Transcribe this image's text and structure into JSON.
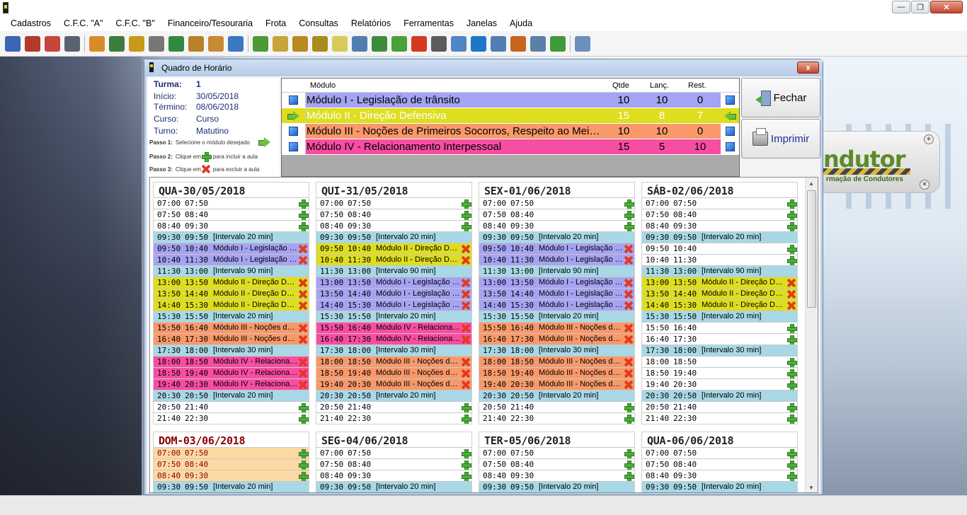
{
  "menu": [
    "Cadastros",
    "C.F.C. \"A\"",
    "C.F.C. \"B\"",
    "Financeiro/Tesouraria",
    "Frota",
    "Consultas",
    "Relatórios",
    "Ferramentas",
    "Janelas",
    "Ajuda"
  ],
  "toolbar_icons": [
    "users-icon",
    "truck-icon",
    "shop-icon",
    "car-icon",
    "handshake-icon",
    "document-icon",
    "book-icon",
    "book-gray-icon",
    "book-green-icon",
    "tools-icon",
    "clipboard-icon",
    "id-card-icon",
    "money-icon",
    "box-icon",
    "money-bag-icon",
    "money-bag-add-icon",
    "notes-icon",
    "calculator-icon",
    "cash-icon",
    "chart-icon",
    "fire-extinguisher-icon",
    "phone-icon",
    "mail-icon",
    "teamviewer-icon",
    "list-icon",
    "person-lock-icon",
    "gears-icon",
    "person-green-icon",
    "exit-icon"
  ],
  "dialog": {
    "title": "Quadro de Horário",
    "close_label": "x",
    "btn_close": "Fechar",
    "btn_print": "Imprimir"
  },
  "info": {
    "turma_label": "Turma:",
    "turma": "1",
    "inicio_label": "Início:",
    "inicio": "30/05/2018",
    "termino_label": "Término:",
    "termino": "08/06/2018",
    "curso_label": "Curso:",
    "curso": "Curso",
    "turno_label": "Turno:",
    "turno": "Matutino",
    "passo1_label": "Passo 1:",
    "passo1": "Selecione o módulo desejado",
    "passo2_label": "Passo 2:",
    "passo2a": "Clique em",
    "passo2b": "para incluir a aula",
    "passo3_label": "Passo 3:",
    "passo3a": "Clique em",
    "passo3b": "para excluir a aula"
  },
  "modules_header": {
    "modulo": "Módulo",
    "qtde": "Qtde",
    "lanc": "Lanç.",
    "rest": "Rest."
  },
  "modules": [
    {
      "name": "Módulo I - Legislação de trânsito",
      "qtde": "10",
      "lanc": "10",
      "rest": "0",
      "color": "#a6a3f2",
      "selected": false
    },
    {
      "name": "Módulo II - Direção Defensiva",
      "qtde": "15",
      "lanc": "8",
      "rest": "7",
      "color": "#dede1f",
      "selected": true
    },
    {
      "name": "Módulo III - Noções de Primeiros Socorros, Respeito ao Meio Ambiente e de Convívio Social no Trânsito",
      "qtde": "10",
      "lanc": "10",
      "rest": "0",
      "color": "#f7996a",
      "selected": false
    },
    {
      "name": "Módulo IV - Relacionamento Interpessoal",
      "qtde": "15",
      "lanc": "5",
      "rest": "10",
      "color": "#f74da2",
      "selected": false
    }
  ],
  "days": [
    {
      "title": "QUA-30/05/2018",
      "sunday": false,
      "slots": [
        [
          "07:00",
          "07:50",
          "",
          "free"
        ],
        [
          "07:50",
          "08:40",
          "",
          "free"
        ],
        [
          "08:40",
          "09:30",
          "",
          "free"
        ],
        [
          "09:30",
          "09:50",
          "[Intervalo 20 min]",
          "int"
        ],
        [
          "09:50",
          "10:40",
          "Módulo I - Legislação de trânsito",
          "m1"
        ],
        [
          "10:40",
          "11:30",
          "Módulo I - Legislação de trânsito",
          "m1"
        ],
        [
          "11:30",
          "13:00",
          "[Intervalo 90 min]",
          "int"
        ],
        [
          "13:00",
          "13:50",
          "Módulo II - Direção Defensiva",
          "m2"
        ],
        [
          "13:50",
          "14:40",
          "Módulo II - Direção Defensiva",
          "m2"
        ],
        [
          "14:40",
          "15:30",
          "Módulo II - Direção Defensiva",
          "m2"
        ],
        [
          "15:30",
          "15:50",
          "[Intervalo 20 min]",
          "int"
        ],
        [
          "15:50",
          "16:40",
          "Módulo III - Noções de Primeiros Socorros",
          "m3"
        ],
        [
          "16:40",
          "17:30",
          "Módulo III - Noções de Primeiros Socorros",
          "m3"
        ],
        [
          "17:30",
          "18:00",
          "[Intervalo 30 min]",
          "int"
        ],
        [
          "18:00",
          "18:50",
          "Módulo IV - Relacionamento Interpessoal",
          "m4"
        ],
        [
          "18:50",
          "19:40",
          "Módulo IV - Relacionamento Interpessoal",
          "m4"
        ],
        [
          "19:40",
          "20:30",
          "Módulo IV - Relacionamento Interpessoal",
          "m4"
        ],
        [
          "20:30",
          "20:50",
          "[Intervalo 20 min]",
          "int"
        ],
        [
          "20:50",
          "21:40",
          "",
          "free"
        ],
        [
          "21:40",
          "22:30",
          "",
          "free"
        ]
      ]
    },
    {
      "title": "QUI-31/05/2018",
      "sunday": false,
      "slots": [
        [
          "07:00",
          "07:50",
          "",
          "free"
        ],
        [
          "07:50",
          "08:40",
          "",
          "free"
        ],
        [
          "08:40",
          "09:30",
          "",
          "free"
        ],
        [
          "09:30",
          "09:50",
          "[Intervalo 20 min]",
          "int"
        ],
        [
          "09:50",
          "10:40",
          "Módulo II - Direção Defensiva",
          "m2"
        ],
        [
          "10:40",
          "11:30",
          "Módulo II - Direção Defensiva",
          "m2"
        ],
        [
          "11:30",
          "13:00",
          "[Intervalo 90 min]",
          "int"
        ],
        [
          "13:00",
          "13:50",
          "Módulo I - Legislação de trânsito",
          "m1"
        ],
        [
          "13:50",
          "14:40",
          "Módulo I - Legislação de trânsito",
          "m1"
        ],
        [
          "14:40",
          "15:30",
          "Módulo I - Legislação de trânsito",
          "m1"
        ],
        [
          "15:30",
          "15:50",
          "[Intervalo 20 min]",
          "int"
        ],
        [
          "15:50",
          "16:40",
          "Módulo IV - Relacionamento Interpessoal",
          "m4"
        ],
        [
          "16:40",
          "17:30",
          "Módulo IV - Relacionamento Interpessoal",
          "m4"
        ],
        [
          "17:30",
          "18:00",
          "[Intervalo 30 min]",
          "int"
        ],
        [
          "18:00",
          "18:50",
          "Módulo III - Noções de Primeiros Socorros",
          "m3"
        ],
        [
          "18:50",
          "19:40",
          "Módulo III - Noções de Primeiros Socorros",
          "m3"
        ],
        [
          "19:40",
          "20:30",
          "Módulo III - Noções de Primeiros Socorros",
          "m3"
        ],
        [
          "20:30",
          "20:50",
          "[Intervalo 20 min]",
          "int"
        ],
        [
          "20:50",
          "21:40",
          "",
          "free"
        ],
        [
          "21:40",
          "22:30",
          "",
          "free"
        ]
      ]
    },
    {
      "title": "SEX-01/06/2018",
      "sunday": false,
      "slots": [
        [
          "07:00",
          "07:50",
          "",
          "free"
        ],
        [
          "07:50",
          "08:40",
          "",
          "free"
        ],
        [
          "08:40",
          "09:30",
          "",
          "free"
        ],
        [
          "09:30",
          "09:50",
          "[Intervalo 20 min]",
          "int"
        ],
        [
          "09:50",
          "10:40",
          "Módulo I - Legislação de trânsito",
          "m1"
        ],
        [
          "10:40",
          "11:30",
          "Módulo I - Legislação de trânsito",
          "m1"
        ],
        [
          "11:30",
          "13:00",
          "[Intervalo 90 min]",
          "int"
        ],
        [
          "13:00",
          "13:50",
          "Módulo I - Legislação de trânsito",
          "m1"
        ],
        [
          "13:50",
          "14:40",
          "Módulo I - Legislação de trânsito",
          "m1"
        ],
        [
          "14:40",
          "15:30",
          "Módulo I - Legislação de trânsito",
          "m1"
        ],
        [
          "15:30",
          "15:50",
          "[Intervalo 20 min]",
          "int"
        ],
        [
          "15:50",
          "16:40",
          "Módulo III - Noções de Primeiros Socorros",
          "m3"
        ],
        [
          "16:40",
          "17:30",
          "Módulo III - Noções de Primeiros Socorros",
          "m3"
        ],
        [
          "17:30",
          "18:00",
          "[Intervalo 30 min]",
          "int"
        ],
        [
          "18:00",
          "18:50",
          "Módulo III - Noções de Primeiros Socorros",
          "m3"
        ],
        [
          "18:50",
          "19:40",
          "Módulo III - Noções de Primeiros Socorros",
          "m3"
        ],
        [
          "19:40",
          "20:30",
          "Módulo III - Noções de Primeiros Socorros",
          "m3"
        ],
        [
          "20:30",
          "20:50",
          "[Intervalo 20 min]",
          "int"
        ],
        [
          "20:50",
          "21:40",
          "",
          "free"
        ],
        [
          "21:40",
          "22:30",
          "",
          "free"
        ]
      ]
    },
    {
      "title": "SÁB-02/06/2018",
      "sunday": false,
      "slots": [
        [
          "07:00",
          "07:50",
          "",
          "free"
        ],
        [
          "07:50",
          "08:40",
          "",
          "free"
        ],
        [
          "08:40",
          "09:30",
          "",
          "free"
        ],
        [
          "09:30",
          "09:50",
          "[Intervalo 20 min]",
          "int"
        ],
        [
          "09:50",
          "10:40",
          "",
          "free"
        ],
        [
          "10:40",
          "11:30",
          "",
          "free"
        ],
        [
          "11:30",
          "13:00",
          "[Intervalo 90 min]",
          "int"
        ],
        [
          "13:00",
          "13:50",
          "Módulo II - Direção Defensiva",
          "m2"
        ],
        [
          "13:50",
          "14:40",
          "Módulo II - Direção Defensiva",
          "m2"
        ],
        [
          "14:40",
          "15:30",
          "Módulo II - Direção Defensiva",
          "m2"
        ],
        [
          "15:30",
          "15:50",
          "[Intervalo 20 min]",
          "int"
        ],
        [
          "15:50",
          "16:40",
          "",
          "free"
        ],
        [
          "16:40",
          "17:30",
          "",
          "free"
        ],
        [
          "17:30",
          "18:00",
          "[Intervalo 30 min]",
          "int"
        ],
        [
          "18:00",
          "18:50",
          "",
          "free"
        ],
        [
          "18:50",
          "19:40",
          "",
          "free"
        ],
        [
          "19:40",
          "20:30",
          "",
          "free"
        ],
        [
          "20:30",
          "20:50",
          "[Intervalo 20 min]",
          "int"
        ],
        [
          "20:50",
          "21:40",
          "",
          "free"
        ],
        [
          "21:40",
          "22:30",
          "",
          "free"
        ]
      ]
    },
    {
      "title": "DOM-03/06/2018",
      "sunday": true,
      "slots": [
        [
          "07:00",
          "07:50",
          "",
          "sun"
        ],
        [
          "07:50",
          "08:40",
          "",
          "sun"
        ],
        [
          "08:40",
          "09:30",
          "",
          "sun"
        ],
        [
          "09:30",
          "09:50",
          "[Intervalo 20 min]",
          "int"
        ]
      ]
    },
    {
      "title": "SEG-04/06/2018",
      "sunday": false,
      "slots": [
        [
          "07:00",
          "07:50",
          "",
          "free"
        ],
        [
          "07:50",
          "08:40",
          "",
          "free"
        ],
        [
          "08:40",
          "09:30",
          "",
          "free"
        ],
        [
          "09:30",
          "09:50",
          "[Intervalo 20 min]",
          "int"
        ]
      ]
    },
    {
      "title": "TER-05/06/2018",
      "sunday": false,
      "slots": [
        [
          "07:00",
          "07:50",
          "",
          "free"
        ],
        [
          "07:50",
          "08:40",
          "",
          "free"
        ],
        [
          "08:40",
          "09:30",
          "",
          "free"
        ],
        [
          "09:30",
          "09:50",
          "[Intervalo 20 min]",
          "int"
        ]
      ]
    },
    {
      "title": "QUA-06/06/2018",
      "sunday": false,
      "slots": [
        [
          "07:00",
          "07:50",
          "",
          "free"
        ],
        [
          "07:50",
          "08:40",
          "",
          "free"
        ],
        [
          "08:40",
          "09:30",
          "",
          "free"
        ],
        [
          "09:30",
          "09:50",
          "[Intervalo 20 min]",
          "int"
        ]
      ]
    }
  ],
  "logo": {
    "text": "ndutor",
    "sub": "rmação de Condutores"
  }
}
